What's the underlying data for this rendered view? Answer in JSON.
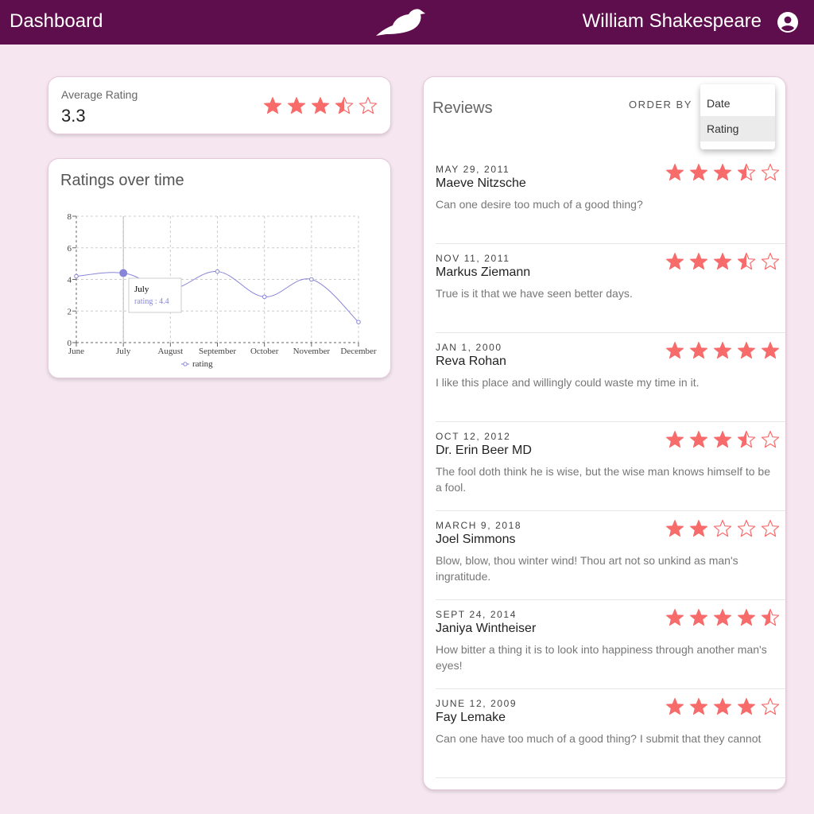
{
  "header": {
    "title": "Dashboard",
    "logo_icon": "bird-logo-icon",
    "user_name": "William Shakespeare",
    "avatar_icon": "account-circle-icon"
  },
  "colors": {
    "header_bg": "#5e0e4c",
    "page_bg": "#f5e6ef",
    "star": "#f86b6b",
    "chart_line": "#8884d8"
  },
  "average": {
    "label": "Average Rating",
    "value": "3.3",
    "rating": 3.5
  },
  "chart": {
    "title": "Ratings over time",
    "tooltip": {
      "title": "July",
      "text": "rating : 4.4"
    },
    "legend": "rating"
  },
  "chart_data": {
    "type": "line",
    "x": [
      "June",
      "July",
      "August",
      "September",
      "October",
      "November",
      "December"
    ],
    "series": [
      {
        "name": "rating",
        "values": [
          4.2,
          4.4,
          3.4,
          4.5,
          2.9,
          4.0,
          1.3
        ]
      }
    ],
    "ylim": [
      0,
      8
    ],
    "yticks": [
      0,
      2,
      4,
      6,
      8
    ],
    "grid": true,
    "legend": "bottom",
    "active_point": "July"
  },
  "reviews": {
    "title": "Reviews",
    "order_by_label": "ORDER BY",
    "order_options": [
      "Date",
      "Rating"
    ],
    "selected_option": "Rating",
    "items": [
      {
        "date": "MAY 29, 2011",
        "name": "Maeve Nitzsche",
        "text": "Can one desire too much of a good thing?",
        "rating": 3.5
      },
      {
        "date": "NOV 11, 2011",
        "name": "Markus Ziemann",
        "text": "True is it that we have seen better days.",
        "rating": 3.5
      },
      {
        "date": "JAN 1, 2000",
        "name": "Reva Rohan",
        "text": "I like this place and willingly could waste my time in it.",
        "rating": 5
      },
      {
        "date": "OCT 12, 2012",
        "name": "Dr. Erin Beer MD",
        "text": "The fool doth think he is wise, but the wise man knows himself to be a fool.",
        "rating": 3.5
      },
      {
        "date": "MARCH 9, 2018",
        "name": "Joel Simmons",
        "text": "Blow, blow, thou winter wind! Thou art not so unkind as man's ingratitude.",
        "rating": 2
      },
      {
        "date": "SEPT 24, 2014",
        "name": "Janiya Wintheiser",
        "text": "How bitter a thing it is to look into happiness through another man's eyes!",
        "rating": 4.5
      },
      {
        "date": "JUNE 12, 2009",
        "name": "Fay Lemake",
        "text": "Can one have too much of a good thing? I submit that they cannot",
        "rating": 4
      }
    ]
  }
}
